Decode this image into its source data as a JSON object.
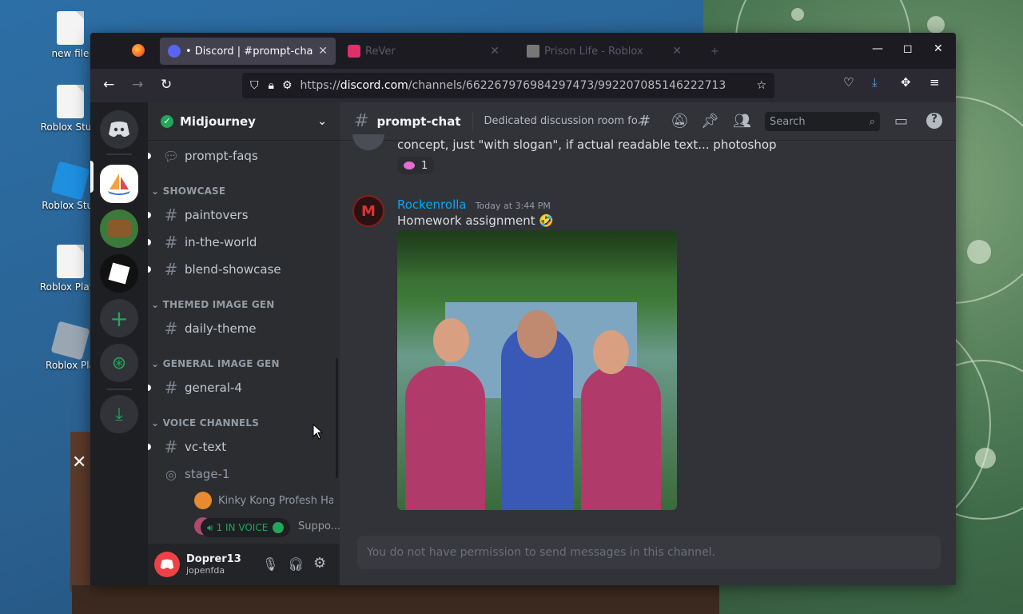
{
  "desktop": {
    "icons": [
      {
        "label": "new file"
      },
      {
        "label": "Roblox Studi"
      },
      {
        "label": "Roblox Stud"
      },
      {
        "label": "Roblox Playe"
      },
      {
        "label": "Roblox Pla"
      }
    ]
  },
  "browser": {
    "tabs": [
      {
        "label": "• Discord | #prompt-chat | M",
        "active": true
      },
      {
        "label": "ReVer"
      },
      {
        "label": "Prison Life - Roblox"
      }
    ],
    "url": {
      "prefix": "https://",
      "host": "discord.com",
      "path": "/channels/662267976984297473/992207085146222713"
    }
  },
  "discord": {
    "guild_name": "Midjourney",
    "channels": [
      {
        "type": "thread",
        "label": "prompt-faqs"
      },
      {
        "type": "category",
        "label": "SHOWCASE"
      },
      {
        "type": "text",
        "label": "paintovers"
      },
      {
        "type": "text",
        "label": "in-the-world"
      },
      {
        "type": "text",
        "label": "blend-showcase"
      },
      {
        "type": "category",
        "label": "THEMED IMAGE GEN"
      },
      {
        "type": "text",
        "label": "daily-theme"
      },
      {
        "type": "category",
        "label": "GENERAL IMAGE GEN"
      },
      {
        "type": "forum",
        "label": "general-4"
      },
      {
        "type": "category",
        "label": "VOICE CHANNELS"
      },
      {
        "type": "text",
        "label": "vc-text"
      },
      {
        "type": "stage",
        "label": "stage-1"
      }
    ],
    "voice_users": [
      {
        "name": "Kinky Kong Profesh Ha..."
      },
      {
        "name": "Suppo..."
      }
    ],
    "voice_pill": "1 IN VOICE",
    "user": {
      "name": "Doprer13",
      "tag": "jopenfda"
    },
    "chat": {
      "channel": "prompt-chat",
      "topic": "Dedicated discussion room fo...",
      "search_placeholder": "Search",
      "prev_message_tail": "concept, just \"with slogan\", if actual readable text... photoshop",
      "reaction_count": "1",
      "message": {
        "author": "Rockenrolla",
        "timestamp": "Today at 3:44 PM",
        "text": "Homework assignment 🤣"
      },
      "composer_text": "You do not have permission to send messages in this channel."
    }
  },
  "colors": {
    "accent": "#5865f2",
    "link": "#00a8fc",
    "online": "#23a55a"
  }
}
